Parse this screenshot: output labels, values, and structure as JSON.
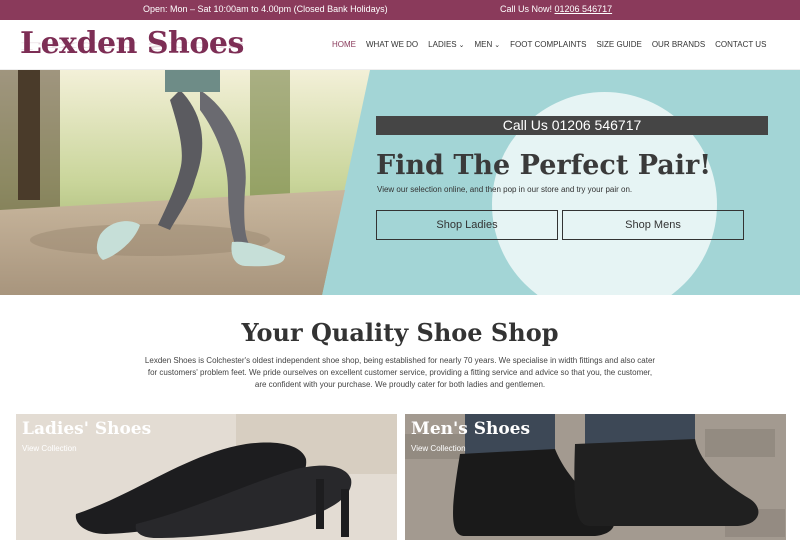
{
  "topbar": {
    "hours": "Open: Mon – Sat 10:00am to 4.00pm (Closed Bank Holidays)",
    "call_label": "Call Us Now!",
    "call_number": "01206 546717"
  },
  "header": {
    "logo": "Lexden Shoes",
    "nav": [
      {
        "label": "HOME",
        "active": true
      },
      {
        "label": "WHAT WE DO"
      },
      {
        "label": "LADIES",
        "dropdown": true
      },
      {
        "label": "MEN",
        "dropdown": true
      },
      {
        "label": "FOOT COMPLAINTS"
      },
      {
        "label": "SIZE GUIDE"
      },
      {
        "label": "OUR BRANDS"
      },
      {
        "label": "CONTACT US"
      }
    ]
  },
  "hero": {
    "call_bar": "Call Us 01206 546717",
    "title": "Find The Perfect Pair!",
    "subtitle": "View our selection online, and then pop in our store and try your pair on.",
    "btn_ladies": "Shop Ladies",
    "btn_mens": "Shop Mens"
  },
  "about": {
    "title": "Your Quality Shoe Shop",
    "text": "Lexden Shoes is Colchester's oldest independent shoe shop, being established for nearly 70 years. We specialise in width fittings and also cater for customers' problem feet. We pride ourselves on excellent customer service, providing a fitting service and advice so that you, the customer, are confident with your purchase. We proudly cater for both ladies and gentlemen."
  },
  "tiles": {
    "ladies": {
      "title": "Ladies' Shoes",
      "link": "View Collection"
    },
    "mens": {
      "title": "Men's Shoes",
      "link": "View Collection"
    }
  },
  "colors": {
    "brand": "#8a3a5b",
    "hero_bg": "#a3d5d6",
    "call_bar": "#454545"
  }
}
